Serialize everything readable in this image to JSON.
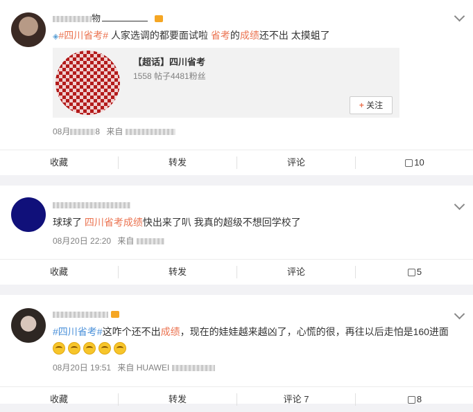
{
  "comments": [
    {
      "username_visible": "物",
      "topic": "#四川省考#",
      "text_part1": "人家选调的都要面试啦",
      "kw1": "省考",
      "text_part2": "的",
      "kw2": "成绩",
      "text_part3": "还不出 太摸蛆了",
      "card": {
        "title": "【超话】四川省考",
        "stats": "1558 帖子4481粉丝",
        "follow_label": "关注"
      },
      "date_prefix": "08月",
      "date_suffix": "8",
      "source_label": "来自"
    },
    {
      "text_part1": "球球了",
      "topic": "四川省考成绩",
      "text_part2": "快出来了叭 我真的超级不想回学校了",
      "date": "08月20日 22:20",
      "source_label": "来自"
    },
    {
      "topic": "#四川省考#",
      "text_part1": "这咋个还不出",
      "kw1": "成绩",
      "text_part2": "，现在的娃娃越来越凶了，心慌的很，再往以后走怕是160进面",
      "emoji_count": 5,
      "date": "08月20日 19:51",
      "source_label": "来自 HUAWEI"
    }
  ],
  "actions": {
    "collect": "收藏",
    "repost": "转发",
    "comment": "评论",
    "comment_7": "评论 7"
  },
  "likes": [
    "10",
    "5",
    "8"
  ]
}
